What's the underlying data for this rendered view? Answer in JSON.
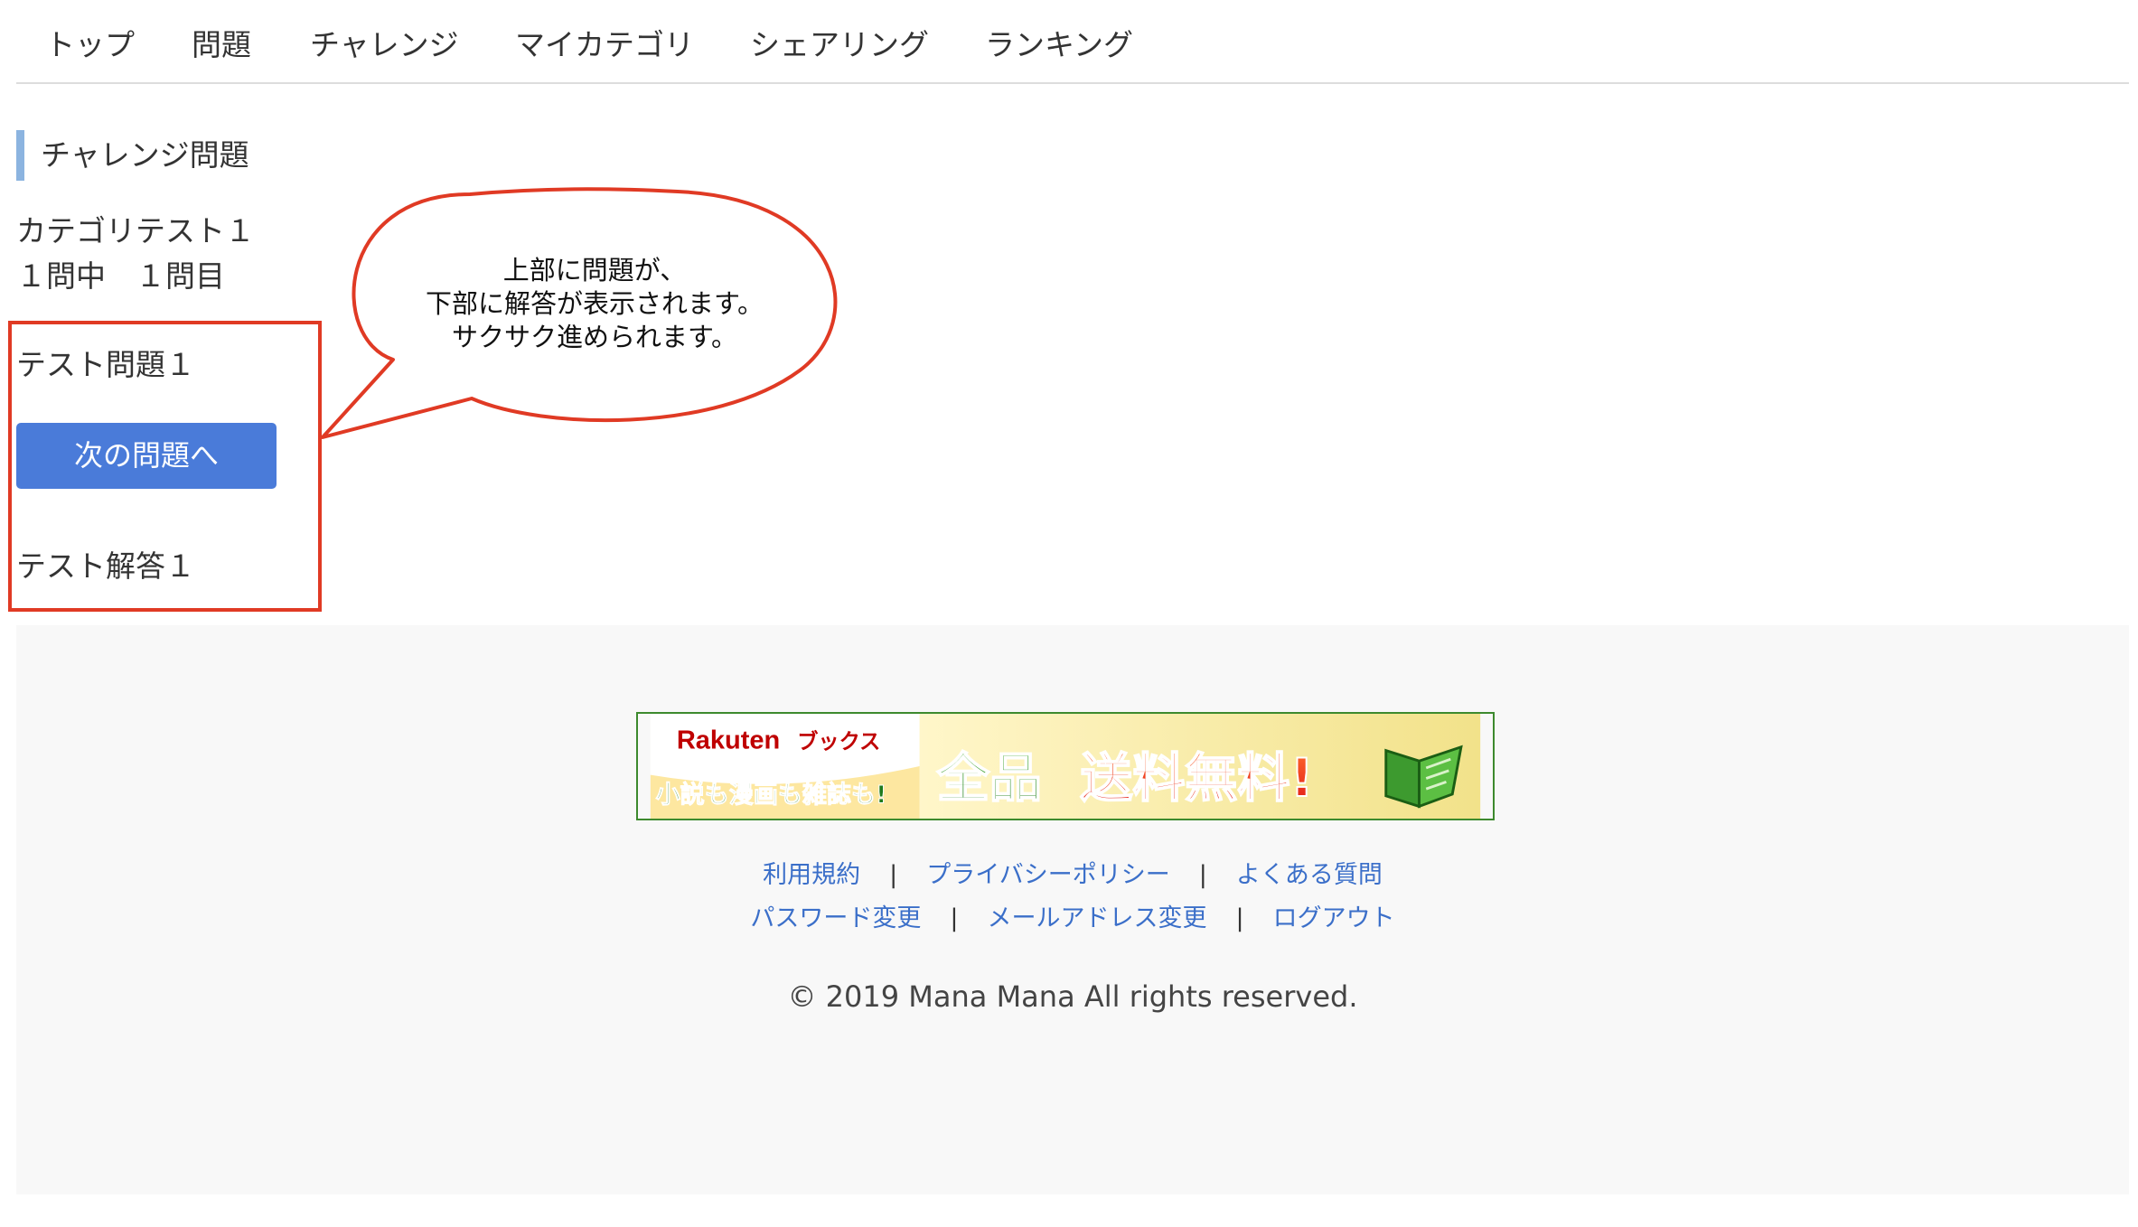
{
  "nav": {
    "items": [
      {
        "label": "トップ"
      },
      {
        "label": "問題"
      },
      {
        "label": "チャレンジ"
      },
      {
        "label": "マイカテゴリ"
      },
      {
        "label": "シェアリング"
      },
      {
        "label": "ランキング"
      }
    ]
  },
  "main": {
    "section_title": "チャレンジ問題",
    "category_name": "カテゴリテスト１",
    "progress": "１問中　１問目",
    "question": "テスト問題１",
    "next_button_label": "次の問題へ",
    "answer": "テスト解答１"
  },
  "annotation": {
    "lines": [
      "上部に問題が、",
      "下部に解答が表示されます。",
      "サクサク進められます。"
    ],
    "color": "#e03a24"
  },
  "banner": {
    "brand": "Rakuten",
    "brand_suffix": "ブックス",
    "tagline": "小説も漫画も雑誌も!",
    "headline_a": "全品",
    "headline_b": "送料無料!",
    "icon": "book-icon"
  },
  "footer": {
    "links_row1": [
      "利用規約",
      "プライバシーポリシー",
      "よくある質問"
    ],
    "links_row2": [
      "パスワード変更",
      "メールアドレス変更",
      "ログアウト"
    ],
    "separator": "|",
    "copyright": "© 2019 Mana Mana All rights reserved."
  },
  "colors": {
    "primary_button": "#4a7bd9",
    "link": "#3b6fc9",
    "heading_accent": "#8cb4e0",
    "footer_bg": "#f8f8f8"
  }
}
